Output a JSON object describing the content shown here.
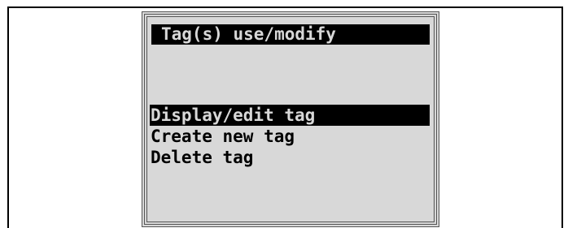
{
  "screen": {
    "title": "Tag(s) use/modify"
  },
  "menu": {
    "selected_index": 0,
    "items": [
      {
        "label": "Display/edit tag"
      },
      {
        "label": "Create new tag"
      },
      {
        "label": "Delete tag"
      }
    ]
  },
  "colors": {
    "screen_background": "#d8d8d8",
    "highlight_background": "#000000",
    "text": "#000000"
  }
}
